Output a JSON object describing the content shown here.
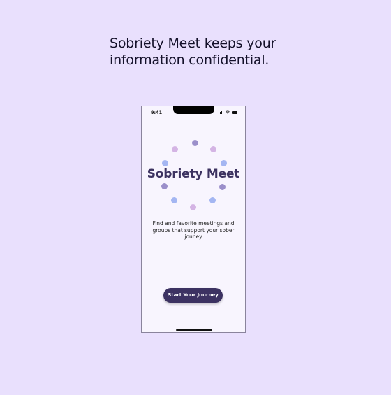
{
  "headline": {
    "text": "Sobriety Meet keeps your information confidential."
  },
  "phone": {
    "status_bar": {
      "time": "9:41",
      "icons": [
        "signal-icon",
        "wifi-icon",
        "battery-icon"
      ]
    },
    "logo": {
      "title": "Sobriety Meet",
      "title_color": "#3c3260",
      "dot_colors": {
        "purple": "#9b8fca",
        "pink": "#d4b4e4",
        "blue": "#a4b6f2"
      }
    },
    "tagline": "Find and favorite meetings and groups that support your sober jouney",
    "cta_button": {
      "label": "Start Your Journey",
      "background": "#3c3262"
    }
  },
  "colors": {
    "page_background": "#e9e0fd",
    "screen_background": "#f8f5fe"
  }
}
